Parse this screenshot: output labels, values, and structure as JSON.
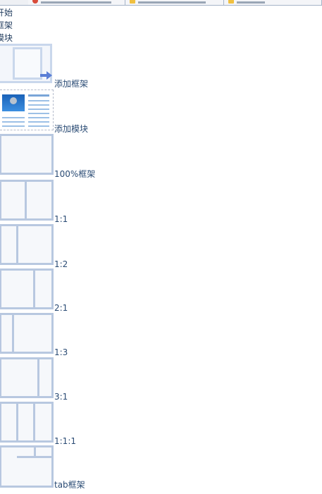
{
  "tabs": [
    {
      "icon": "red-icon",
      "color": "#d84b3a"
    },
    {
      "icon": "folder-icon",
      "color": "#f0c040"
    },
    {
      "icon": "folder-icon",
      "color": "#f0c040"
    }
  ],
  "menu": [
    {
      "label": "开始",
      "icon": "start"
    },
    {
      "label": "框架",
      "icon": "frame"
    },
    {
      "label": "模块",
      "icon": "module"
    }
  ],
  "gallery": {
    "add_frame_label": "添加框架",
    "add_module_label": "添加模块",
    "layouts": [
      {
        "label": "100%框架",
        "kind": "full"
      },
      {
        "label": "1:1",
        "kind": "1:1"
      },
      {
        "label": "1:2",
        "kind": "1:2"
      },
      {
        "label": "2:1",
        "kind": "2:1"
      },
      {
        "label": "1:3",
        "kind": "1:3"
      },
      {
        "label": "3:1",
        "kind": "3:1"
      },
      {
        "label": "1:1:1",
        "kind": "1:1:1"
      },
      {
        "label": "tab框架",
        "kind": "tab"
      }
    ]
  },
  "colors": {
    "accent_arrow": "#5b7fd6",
    "thumb_border": "#b8c8e0",
    "text": "#2a4b74"
  }
}
